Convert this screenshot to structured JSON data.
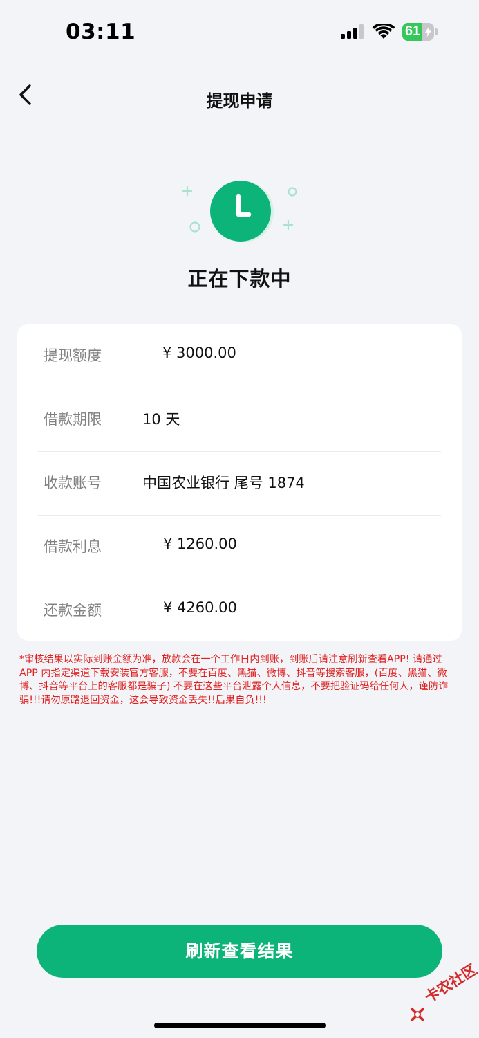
{
  "status_bar": {
    "time": "03:11",
    "battery_level": "61",
    "battery_fraction": 0.61,
    "battery_charging": true
  },
  "nav": {
    "title": "提现申请"
  },
  "status": {
    "heading": "正在下款中",
    "icon": "clock-icon",
    "accent_color": "#0db47a"
  },
  "details": [
    {
      "label": "提现额度",
      "value": "¥ 3000.00"
    },
    {
      "label": "借款期限",
      "value": "10 天"
    },
    {
      "label": "收款账号",
      "value": "中国农业银行 尾号 1874"
    },
    {
      "label": "借款利息",
      "value": "¥ 1260.00"
    },
    {
      "label": "还款金额",
      "value": "¥ 4260.00"
    }
  ],
  "notice": "*审核结果以实际到账金额为准，放款会在一个工作日内到账，到账后请注意刷新查看APP! 请通过 APP 内指定渠道下载安装官方客服，不要在百度、黑猫、微博、抖音等搜索客服，(百度、黑猫、微博、抖音等平台上的客服都是骗子) 不要在这些平台泄露个人信息，不要把验证码给任何人，谨防诈骗!!!请勿原路退回资金，这会导致资金丢失!!后果自负!!!",
  "notice_color": "#e02020",
  "actions": {
    "refresh_label": "刷新查看结果"
  },
  "watermark": {
    "text": "卡农社区"
  }
}
